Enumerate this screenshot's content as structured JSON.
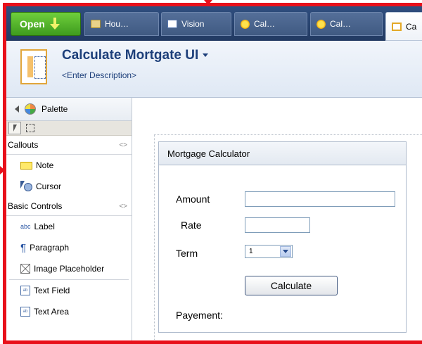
{
  "tabbar": {
    "open_label": "Open",
    "tabs": [
      {
        "label": "Hou…",
        "icon": "folder-icon"
      },
      {
        "label": "Vision",
        "icon": "document-icon"
      },
      {
        "label": "Cal…",
        "icon": "sun-icon"
      },
      {
        "label": "Cal…",
        "icon": "sun-icon"
      },
      {
        "label": "Ca",
        "icon": "layout-icon",
        "active": true
      }
    ]
  },
  "header": {
    "title": "Calculate Mortgate UI",
    "description": "<Enter Description>"
  },
  "palette": {
    "title": "Palette",
    "sections": [
      {
        "title": "Callouts",
        "items": [
          "Note",
          "Cursor"
        ]
      },
      {
        "title": "Basic Controls",
        "items": [
          "Label",
          "Paragraph",
          "Image Placeholder",
          "Text Field",
          "Text Area"
        ]
      }
    ],
    "label_icon_text": "abc",
    "field_icon_text": "ab"
  },
  "form": {
    "title": "Mortgage Calculator",
    "amount_label": "Amount",
    "rate_label": "Rate",
    "term_label": "Term",
    "term_value": "1",
    "calculate_label": "Calculate",
    "payment_label": "Payement:"
  },
  "colors": {
    "annotation": "#e8101a",
    "tabbar": "#2f4e7f",
    "open_button": "#4cae25",
    "title": "#1d3f7a"
  }
}
